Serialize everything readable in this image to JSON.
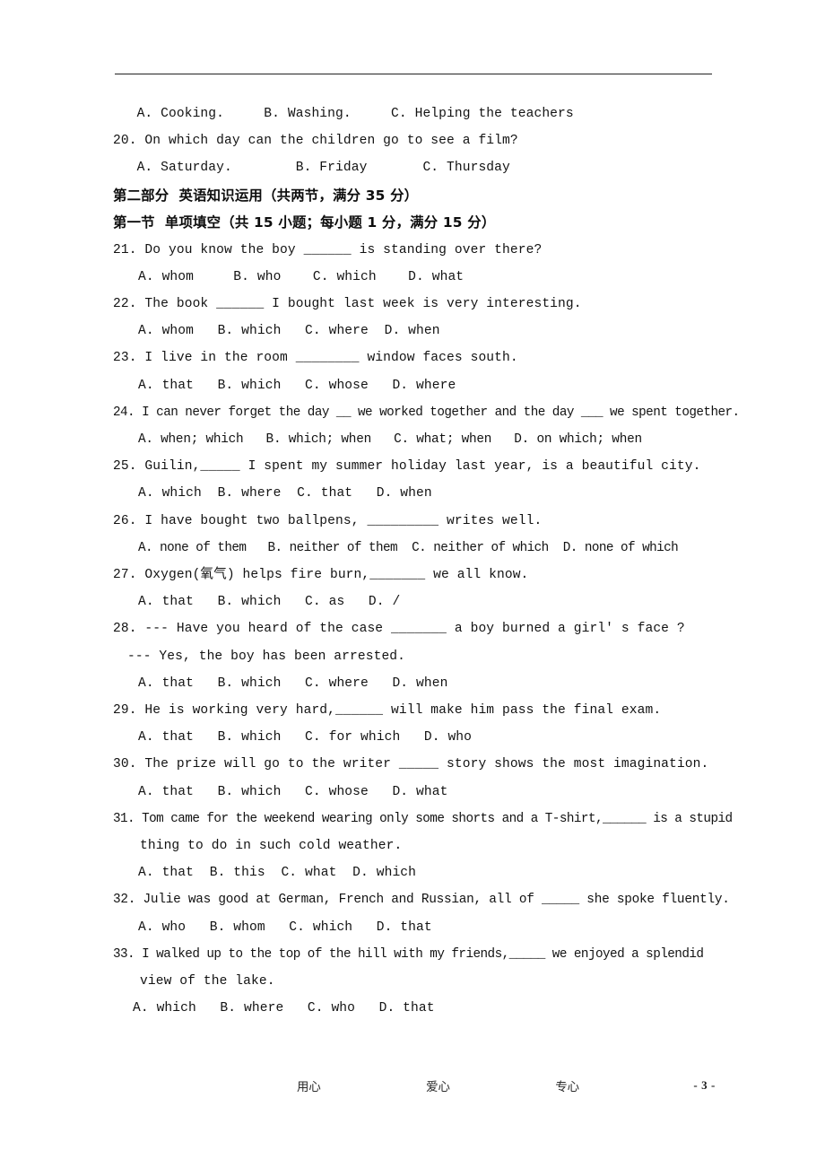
{
  "document": {
    "page_number": "- 3 -",
    "footer_words": [
      "用心",
      "爱心",
      "专心"
    ]
  },
  "listening_tail": {
    "q19_options": "   A. Cooking.     B. Washing.     C. Helping the teachers",
    "q20_stem": "20. On which day can the children go to see a film?",
    "q20_options": "   A. Saturday.        B. Friday       C. Thursday"
  },
  "section_headings": {
    "part_two": "第二部分  英语知识运用（共两节，满分 35 分）",
    "section_one": "第一节  单项填空（共 15 小题；每小题 1 分，满分 15 分）"
  },
  "questions": [
    {
      "number": "21.",
      "stem": "21. Do you know the boy ______ is standing over there?",
      "options": "A. whom     B. who    C. which    D. what",
      "continuation": null
    },
    {
      "number": "22.",
      "stem": "22. The book ______ I bought last week is very interesting.",
      "options": "A. whom   B. which   C. where  D. when",
      "continuation": null
    },
    {
      "number": "23.",
      "stem": "23. I live in the room ________ window faces south.",
      "options": "A. that   B. which   C. whose   D. where",
      "continuation": null
    },
    {
      "number": "24.",
      "stem": "24. I can never forget the day __ we worked together and the day ___ we spent together.",
      "options": "A. when; which   B. which; when   C. what; when   D. on which; when",
      "continuation": null
    },
    {
      "number": "25.",
      "stem": "25. Guilin,_____ I spent my summer holiday last year, is a beautiful city.",
      "options": "A. which  B. where  C. that   D. when",
      "continuation": null
    },
    {
      "number": "26.",
      "stem": "26. I have bought two ballpens, _________ writes well.",
      "options": "A. none of them   B. neither of them  C. neither of which  D. none of which",
      "continuation": null
    },
    {
      "number": "27.",
      "stem": "27. Oxygen(氧气) helps fire burn,_______ we all know.",
      "options": "A. that   B. which   C. as   D. /",
      "continuation": null
    },
    {
      "number": "28.",
      "stem": "28. --- Have you heard of the case _______ a boy burned a girl' s face ?",
      "options": "A. that   B. which   C. where   D. when",
      "continuation": "--- Yes, the boy has been arrested."
    },
    {
      "number": "29.",
      "stem": "29. He is working very hard,______ will make him pass the final exam.",
      "options": "A. that   B. which   C. for which   D. who",
      "continuation": null
    },
    {
      "number": "30.",
      "stem": "30. The prize will go to the writer _____ story shows the most imagination.",
      "options": "A. that   B. which   C. whose   D. what",
      "continuation": null
    },
    {
      "number": "31.",
      "stem": "31. Tom came for the weekend wearing only some shorts and a T-shirt,______ is a stupid",
      "options": "A. that  B. this  C. what  D. which",
      "continuation": "thing to do in such cold weather."
    },
    {
      "number": "32.",
      "stem": "32. Julie was good at German, French and Russian, all of _____ she spoke fluently.",
      "options": "A. who   B. whom   C. which   D. that",
      "continuation": null
    },
    {
      "number": "33.",
      "stem": "33. I walked up to the top of the hill with my friends,_____ we enjoyed a splendid",
      "options": "A. which   B. where   C. who   D. that",
      "continuation": "view of the lake."
    }
  ]
}
